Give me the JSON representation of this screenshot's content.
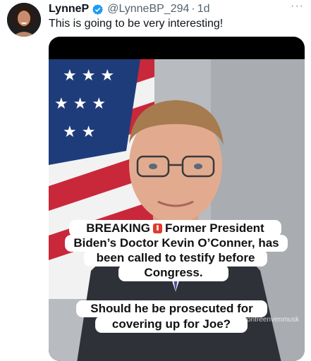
{
  "tweet": {
    "display_name": "LynneP",
    "handle": "@LynneBP_294",
    "separator": "·",
    "time": "1d",
    "more": "···",
    "text": "This is going to be very interesting!"
  },
  "media": {
    "caption": {
      "line1_word": "BREAKING",
      "line1_rest": "Former President",
      "line2": "Biden’s Doctor Kevin O’Conner, has",
      "line3": "been called to testify before",
      "line4": "Congress.",
      "question_line1": "Should he be prosecuted for",
      "question_line2": "covering up for Joe?"
    },
    "watermark": "@elonfreenvenmusk"
  },
  "icons": {
    "verified": "verified-badge-icon",
    "siren": "siren-icon",
    "more": "more-icon"
  },
  "colors": {
    "verified": "#1d9bf0",
    "muted": "#536471"
  }
}
